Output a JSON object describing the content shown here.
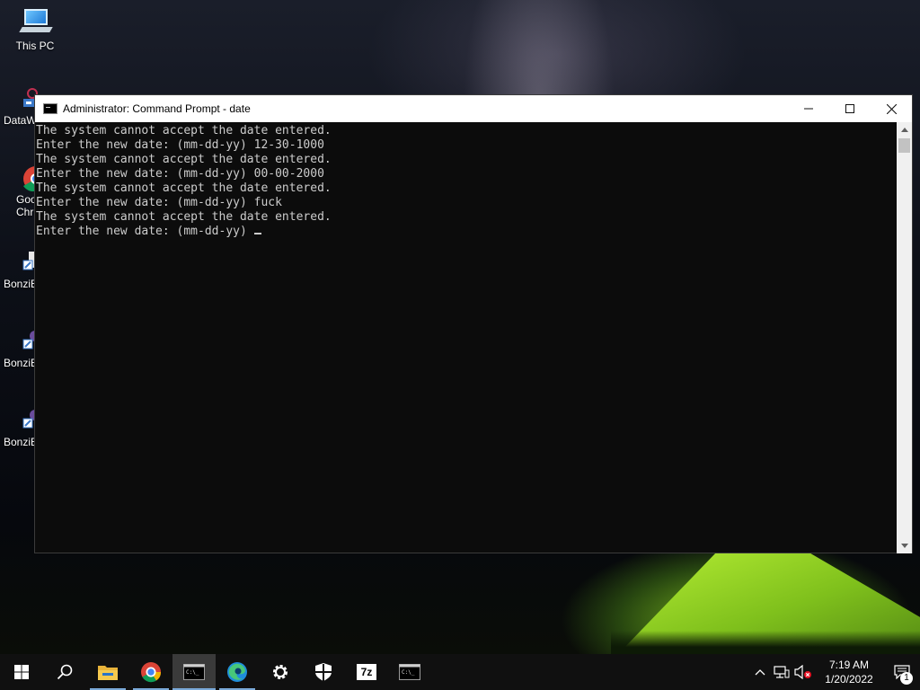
{
  "desktop": {
    "icons": [
      {
        "label": "This PC",
        "icon": "this-pc-icon"
      },
      {
        "label": "DataW",
        "icon": "datawrapper-shortcut-icon"
      },
      {
        "label": "Goo",
        "label2": "Chr",
        "icon": "google-chrome-shortcut-icon"
      },
      {
        "label": "BonziB",
        "icon": "bonzibuddy-shortcut-icon"
      },
      {
        "label": "BonziB",
        "icon": "bonzibuddy-shortcut-icon"
      },
      {
        "label": "BonziB",
        "icon": "bonzibuddy-shortcut-icon"
      }
    ]
  },
  "window": {
    "title": "Administrator: Command Prompt - date",
    "minimize_label": "Minimize",
    "maximize_label": "Maximize",
    "close_label": "Close"
  },
  "console": {
    "lines": [
      "The system cannot accept the date entered.",
      "Enter the new date: (mm-dd-yy) 12-30-1000",
      "The system cannot accept the date entered.",
      "Enter the new date: (mm-dd-yy) 00-00-2000",
      "The system cannot accept the date entered.",
      "Enter the new date: (mm-dd-yy) fuck",
      "The system cannot accept the date entered.",
      "Enter the new date: (mm-dd-yy)"
    ]
  },
  "taskbar": {
    "items": [
      {
        "name": "start-button",
        "icon": "windows-logo-icon"
      },
      {
        "name": "search-button",
        "icon": "search-icon"
      },
      {
        "name": "file-explorer",
        "icon": "folder-icon",
        "running": true
      },
      {
        "name": "google-chrome",
        "icon": "chrome-icon",
        "running": true
      },
      {
        "name": "command-prompt",
        "icon": "cmd-icon",
        "active": true
      },
      {
        "name": "microsoft-edge",
        "icon": "edge-icon",
        "running": true
      },
      {
        "name": "settings",
        "icon": "gear-icon"
      },
      {
        "name": "windows-security",
        "icon": "shield-icon"
      },
      {
        "name": "7-zip",
        "icon": "7zip-icon",
        "text": "7z"
      },
      {
        "name": "command-prompt-2",
        "icon": "cmd-icon"
      }
    ],
    "tray": {
      "time": "7:19 AM",
      "date": "1/20/2022",
      "notification_count": "1"
    }
  },
  "colors": {
    "console_bg": "#0c0c0c",
    "console_text": "#cccccc",
    "taskbar_bg": "#101010",
    "running_indicator": "#7aa9d8"
  }
}
